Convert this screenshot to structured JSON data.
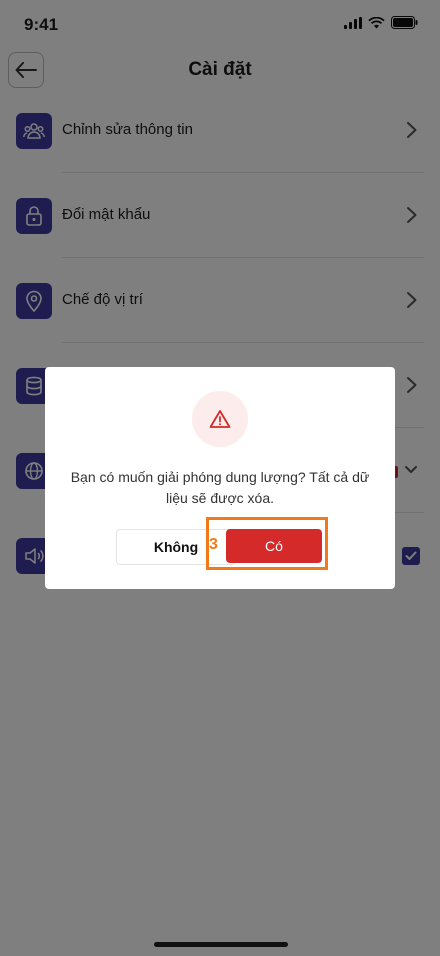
{
  "status_bar": {
    "time": "9:41"
  },
  "header": {
    "title": "Cài đặt"
  },
  "settings_items": [
    {
      "label": "Chỉnh sửa thông tin",
      "icon": "users-icon"
    },
    {
      "label": "Đổi mật khẩu",
      "icon": "lock-icon"
    },
    {
      "label": "Chế độ vị trí",
      "icon": "location-pin-icon"
    },
    {
      "label": "",
      "icon": "database-icon"
    },
    {
      "label": "",
      "icon": "globe-icon"
    },
    {
      "label": "",
      "icon": "speaker-icon"
    }
  ],
  "dialog": {
    "message": "Bạn có muốn giải phóng dung lượng? Tất cả dữ liệu sẽ được xóa.",
    "cancel_label": "Không",
    "confirm_label": "Có"
  },
  "annotation": {
    "step_number": "3"
  },
  "colors": {
    "accent": "#3e3a9e",
    "danger": "#d52a2a",
    "highlight": "#f07a1a"
  }
}
